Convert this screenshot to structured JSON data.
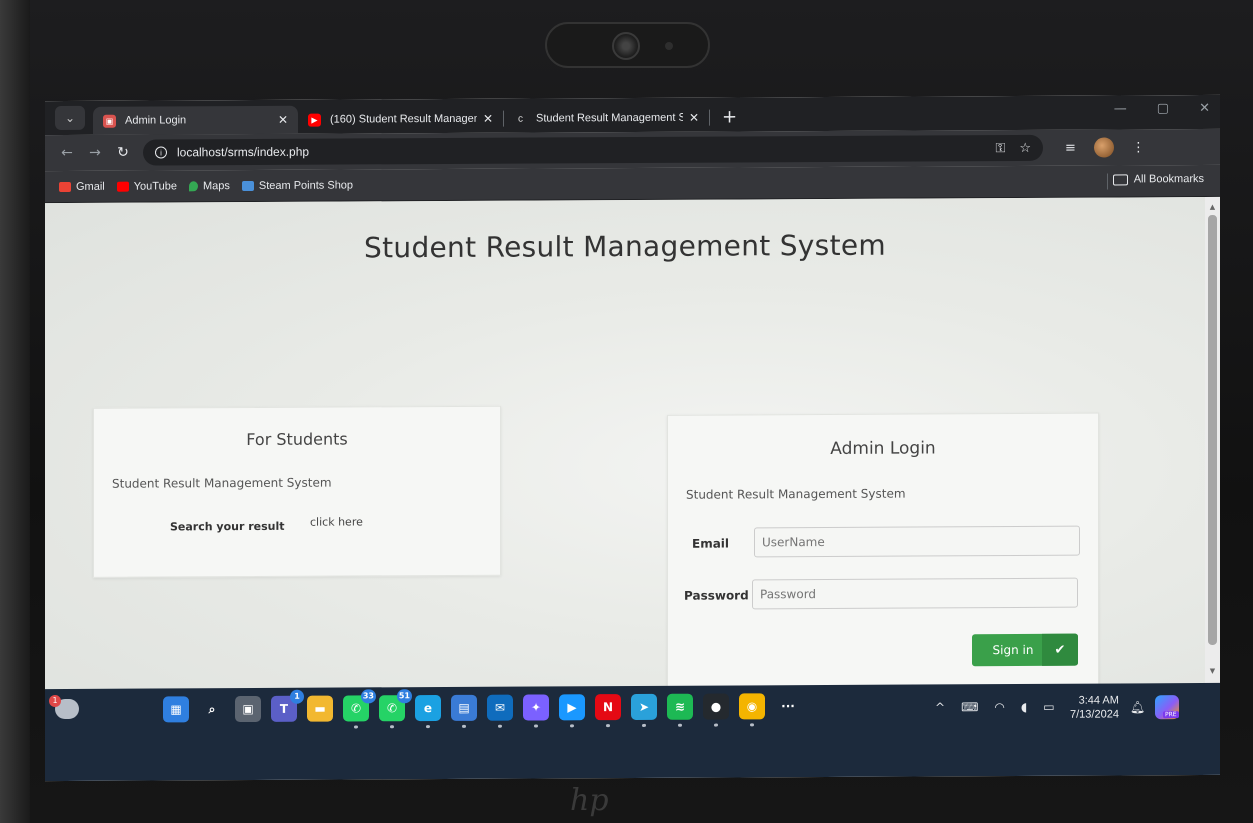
{
  "browser": {
    "tabs": [
      {
        "title": "Admin Login",
        "active": true,
        "favicon_color": "#d9534f"
      },
      {
        "title": "(160) Student Result Managem",
        "active": false,
        "favicon_color": "#ff0000"
      },
      {
        "title": "Student Result Management Sy",
        "active": false,
        "favicon_color": "#dcdcdc"
      }
    ],
    "url": "localhost/srms/index.php",
    "bookmarks": [
      "Gmail",
      "YouTube",
      "Maps",
      "Steam Points Shop"
    ],
    "all_bookmarks_label": "All Bookmarks"
  },
  "page": {
    "title": "Student Result Management System",
    "students_card": {
      "heading": "For Students",
      "subtitle": "Student Result Management System",
      "search_label": "Search your result",
      "link_label": "click here"
    },
    "admin_card": {
      "heading": "Admin Login",
      "subtitle": "Student Result Management System",
      "email_label": "Email",
      "email_placeholder": "UserName",
      "password_label": "Password",
      "password_placeholder": "Password",
      "signin_label": "Sign in"
    }
  },
  "taskbar": {
    "weather_badge": "1",
    "apps": [
      {
        "icon": "windows-start-icon",
        "color": "#2f7fe0",
        "glyph": "▦"
      },
      {
        "icon": "search-icon",
        "color": "transparent",
        "glyph": "⌕"
      },
      {
        "icon": "task-view-icon",
        "color": "#5b6470",
        "glyph": "▣"
      },
      {
        "icon": "teams-icon",
        "color": "#5b5fc7",
        "glyph": "T",
        "badge": "1"
      },
      {
        "icon": "file-explorer-icon",
        "color": "#f2b830",
        "glyph": "▬"
      },
      {
        "icon": "whatsapp-icon",
        "color": "#25d366",
        "glyph": "✆",
        "badge": "33"
      },
      {
        "icon": "whatsapp-business-icon",
        "color": "#25d366",
        "glyph": "✆",
        "badge": "51"
      },
      {
        "icon": "edge-icon",
        "color": "#1ba1e2",
        "glyph": "e"
      },
      {
        "icon": "store-icon",
        "color": "#3a7bd5",
        "glyph": "▤"
      },
      {
        "icon": "mail-icon",
        "color": "#0f6cbd",
        "glyph": "✉"
      },
      {
        "icon": "messenger-icon",
        "color": "#7b61ff",
        "glyph": "✦"
      },
      {
        "icon": "prime-video-icon",
        "color": "#1a98ff",
        "glyph": "▶"
      },
      {
        "icon": "netflix-icon",
        "color": "#e50914",
        "glyph": "N"
      },
      {
        "icon": "telegram-icon",
        "color": "#2aa1da",
        "glyph": "➤"
      },
      {
        "icon": "spotify-icon",
        "color": "#1db954",
        "glyph": "≋"
      },
      {
        "icon": "github-icon",
        "color": "#24292e",
        "glyph": "●"
      },
      {
        "icon": "chrome-icon",
        "color": "#f4b400",
        "glyph": "◉"
      },
      {
        "icon": "more-apps-icon",
        "color": "transparent",
        "glyph": "···"
      }
    ],
    "time": "3:44 AM",
    "date": "7/13/2024"
  }
}
